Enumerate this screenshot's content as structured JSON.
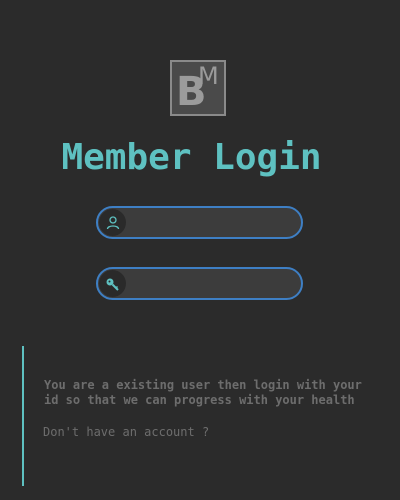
{
  "logo": {
    "letter_main": "B",
    "letter_sup": "M"
  },
  "header": {
    "title": "Member Login"
  },
  "form": {
    "username": {
      "value": "",
      "placeholder": "",
      "icon": "user-icon"
    },
    "password": {
      "value": "",
      "placeholder": "",
      "icon": "key-icon"
    }
  },
  "info": {
    "line1": "You are a existing user then login with your",
    "line2": "id so that we can progress with your health",
    "signup_text": "Don't have an account ?"
  },
  "colors": {
    "background": "#2b2b2b",
    "accent": "#5ec1c1",
    "field_border": "#3e7fc4",
    "muted_text": "#6d6d6d"
  }
}
